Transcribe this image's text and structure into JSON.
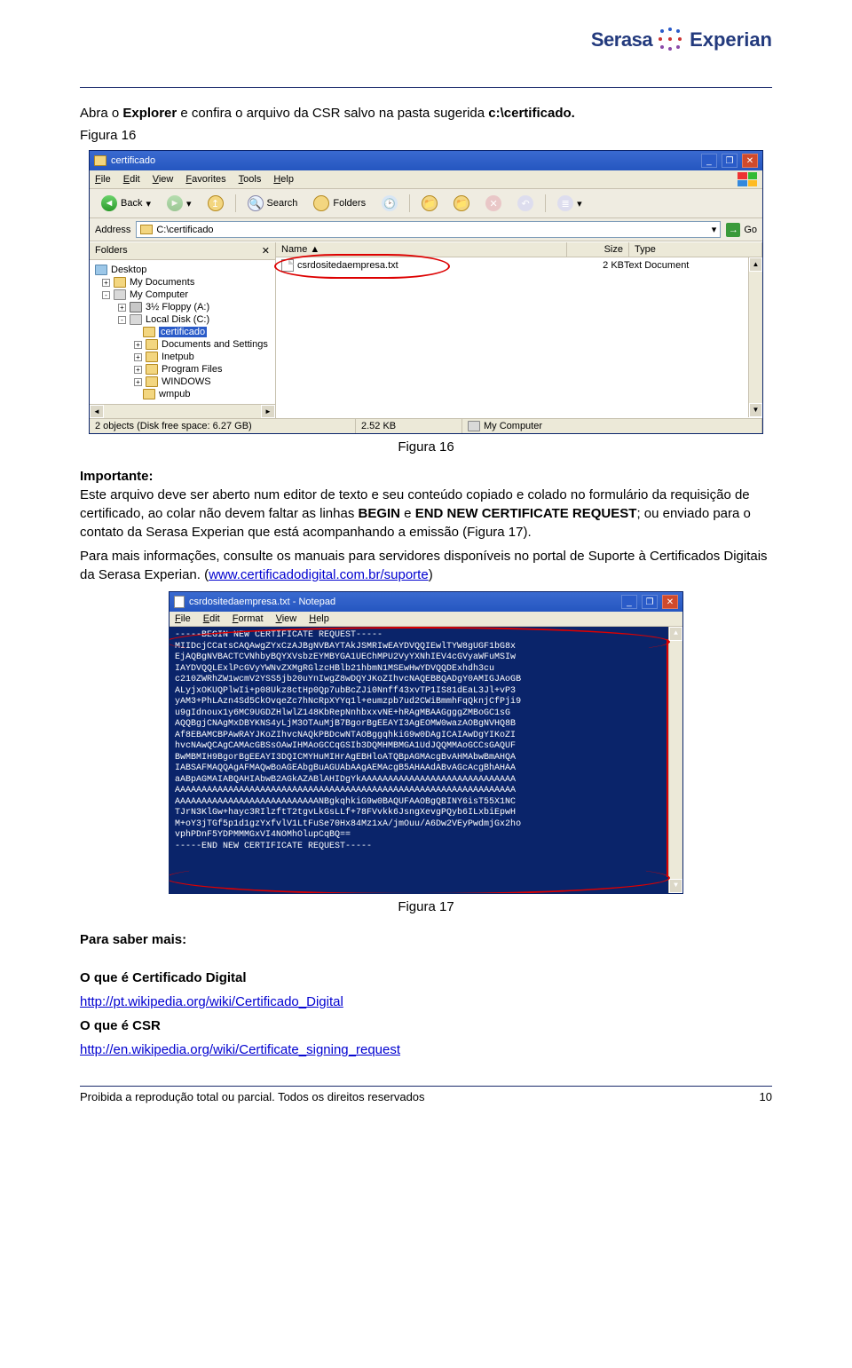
{
  "header": {
    "logo_left": "Serasa",
    "logo_right": "Experian"
  },
  "intro": {
    "pre": "Abra o ",
    "b1": "Explorer",
    "mid": " e confira o arquivo da CSR salvo na pasta sugerida ",
    "b2": "c:\\certificado.",
    "figlabel": "Figura 16"
  },
  "explorer": {
    "title": "certificado",
    "menus": [
      "File",
      "Edit",
      "View",
      "Favorites",
      "Tools",
      "Help"
    ],
    "back": "Back",
    "search": "Search",
    "folders": "Folders",
    "address_label": "Address",
    "address_value": "C:\\certificado",
    "go": "Go",
    "folders_header": "Folders",
    "columns": {
      "name": "Name",
      "size": "Size",
      "type": "Type"
    },
    "tree": {
      "desktop": "Desktop",
      "mydocs": "My Documents",
      "mycomp": "My Computer",
      "floppy": "3½ Floppy (A:)",
      "disk": "Local Disk (C:)",
      "cert": "certificado",
      "docset": "Documents and Settings",
      "inetpub": "Inetpub",
      "progf": "Program Files",
      "windows": "WINDOWS",
      "wmpub": "wmpub"
    },
    "file": {
      "name": "csrdositedaempresa.txt",
      "size": "2 KB",
      "type": "Text Document"
    },
    "status": {
      "objects": "2 objects (Disk free space: 6.27 GB)",
      "size": "2.52 KB",
      "loc": "My Computer"
    }
  },
  "figcap1": "Figura 16",
  "body1": {
    "important_label": "Importante",
    "p1a": "Este arquivo deve ser aberto num editor de texto e seu conteúdo copiado e colado no formulário da requisição de certificado, ao colar não devem faltar as linhas ",
    "p1b": "BEGIN",
    "p1c": " e ",
    "p1d": "END NEW CERTIFICATE REQUEST",
    "p1e": "; ou enviado para o contato da Serasa Experian que está acompanhando a emissão (Figura 17).",
    "p2a": "Para mais informações, consulte os manuais para servidores disponíveis no portal de Suporte à Certificados Digitais da Serasa Experian. (",
    "p2link": "www.certificadodigital.com.br/suporte",
    "p2b": ")"
  },
  "notepad": {
    "title": "csrdositedaempresa.txt - Notepad",
    "menus": [
      "File",
      "Edit",
      "Format",
      "View",
      "Help"
    ],
    "lines": [
      "-----BEGIN NEW CERTIFICATE REQUEST-----",
      "MIIDcjCCatsCAQAwgZYxCzAJBgNVBAYTAkJSMRIwEAYDVQQIEwlTYW8gUGF1bG8x",
      "EjAQBgNVBACTCVNhbyBQYXVsbzEYMBYGA1UEChMPU2VyYXNhIEV4cGVyaWFuMSIw",
      "IAYDVQQLExlPcGVyYWNvZXMgRGlzcHBlb21hbmN1MSEwHwYDVQQDExhdh3cu",
      "c210ZWRhZW1wcmV2YSS5jb20uYnIwgZ8wDQYJKoZIhvcNAQEBBQADgY0AMIGJAoGB",
      "ALyjxOKUQPlwIi+p08Ukz8ctHp0Qp7ubBcZJi0Nnff43xvTP1IS81dEaL3Jl+vP3",
      "yAM3+PhLAzn4Sd5CkOvqeZc7hNcRpXYYq1l+eumzpb7ud2CWiBmmhFqQknjCfPji9",
      "u9gIdnoux1y6MC9UGDZHlwlZ148KbRepNnhbxxvNE+hRAgMBAAGgggZMBoGC1sG",
      "AQQBgjCNAgMxDBYKNS4yLjM3OTAuMjB7BgorBgEEAYI3AgEOMW0wazAOBgNVHQ8B",
      "Af8EBAMCBPAwRAYJKoZIhvcNAQkPBDcwNTAOBggqhkiG9w0DAgICAIAwDgYIKoZI",
      "hvcNAwQCAgCAMAcGBSsOAwIHMAoGCCqGSIb3DQMHMBMGA1UdJQQMMAoGCCsGAQUF",
      "BwMBMIH9BgorBgEEAYI3DQICMYHuMIHrAgEBHloATQBpAGMAcgBvAHMAbwBmAHQA",
      "IABSAFMAQQAgAFMAQwBoAGEAbgBuAGUAbAAgAEMAcgB5AHAAdABvAGcAcgBhAHAA",
      "aABpAGMAIABQAHIAbwB2AGkAZABlAHIDgYkAAAAAAAAAAAAAAAAAAAAAAAAAAAAA",
      "AAAAAAAAAAAAAAAAAAAAAAAAAAAAAAAAAAAAAAAAAAAAAAAAAAAAAAAAAAAAAAAA",
      "AAAAAAAAAAAAAAAAAAAAAAAAAAANBgkqhkiG9w0BAQUFAAOBgQBINY6isT55X1NC",
      "TJrN3KlGw+hayc3RIlzftT2tgvLkGsLLf+78FVvkk6JsngXevgPQyb6ILxbiEpwH",
      "M+oY3jTGf5p1d1gzYxfvlV1LtFuSe70Hx84Mz1xA/jmOuu/A6Dw2VEyPwdmjGx2ho",
      "vphPDnF5YDPMMMGxVI4NOMhOlupCqBQ==",
      "-----END NEW CERTIFICATE REQUEST-----"
    ]
  },
  "figcap2": "Figura 17",
  "more": {
    "heading": "Para saber mais:",
    "q1": "O que é Certificado Digital",
    "l1": "http://pt.wikipedia.org/wiki/Certificado_Digital",
    "q2": "O que é CSR",
    "l2": "http://en.wikipedia.org/wiki/Certificate_signing_request"
  },
  "footer": {
    "left": "Proibida a reprodução total ou parcial. Todos os direitos reservados",
    "right": "10"
  }
}
